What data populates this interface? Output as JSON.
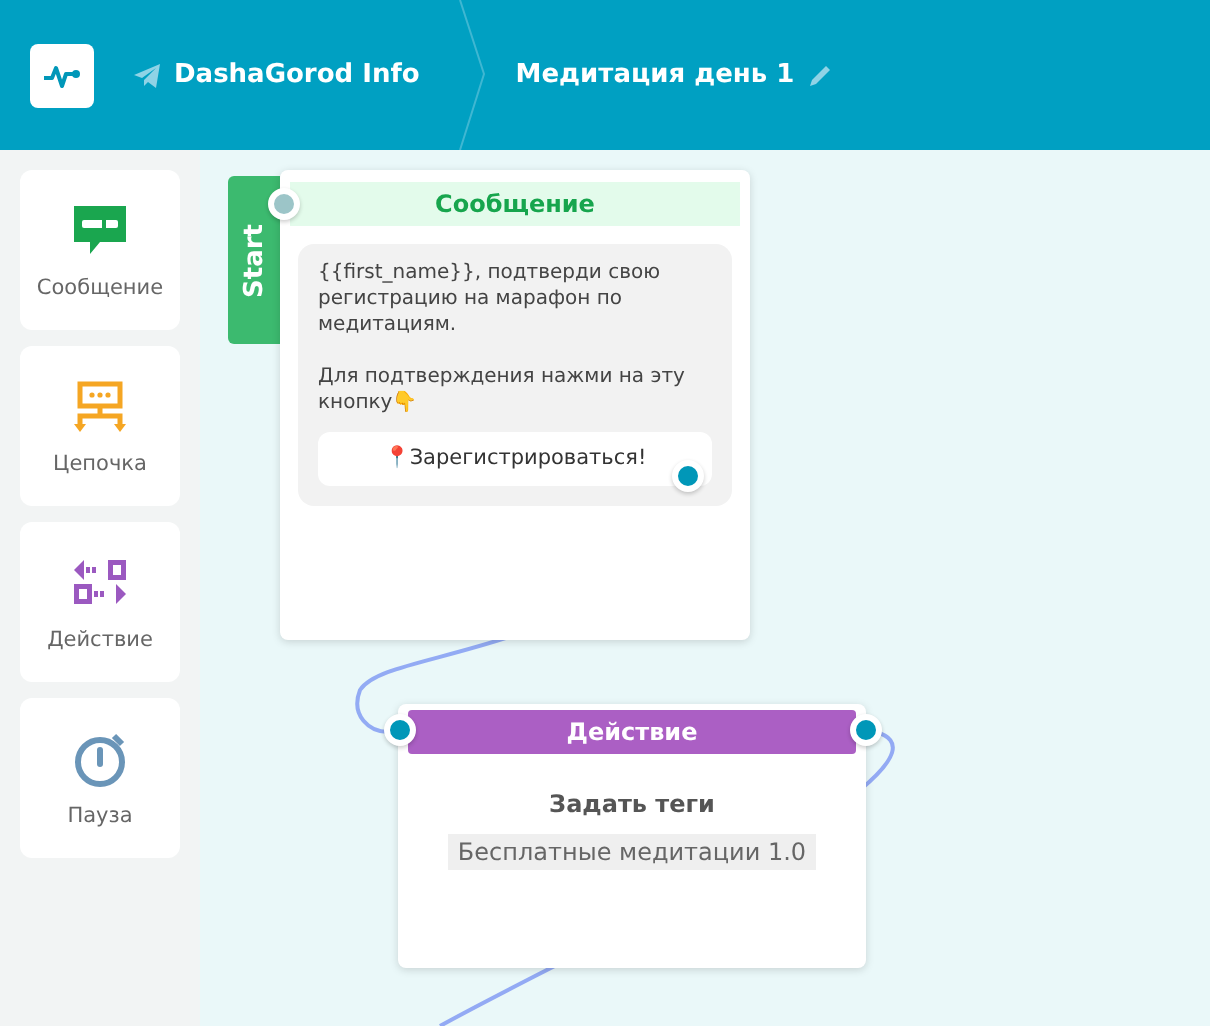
{
  "header": {
    "bot_name": "DashaGorod Info",
    "flow_title": "Медитация день 1"
  },
  "sidebar": {
    "items": [
      {
        "kind": "message",
        "label": "Сообщение"
      },
      {
        "kind": "chain",
        "label": "Цепочка"
      },
      {
        "kind": "action",
        "label": "Действие"
      },
      {
        "kind": "pause",
        "label": "Пауза"
      }
    ]
  },
  "canvas": {
    "start_label": "Start",
    "message_node": {
      "title": "Сообщение",
      "text": "{{first_name}}, подтверди свою регистрацию на марафон по медитациям.\n\nДля подтверждения нажми на эту кнопку👇",
      "button": "📍Зарегистрироваться!"
    },
    "action_node": {
      "title": "Действие",
      "action": "Задать теги",
      "tag": "Бесплатные медитации 1.0"
    }
  }
}
